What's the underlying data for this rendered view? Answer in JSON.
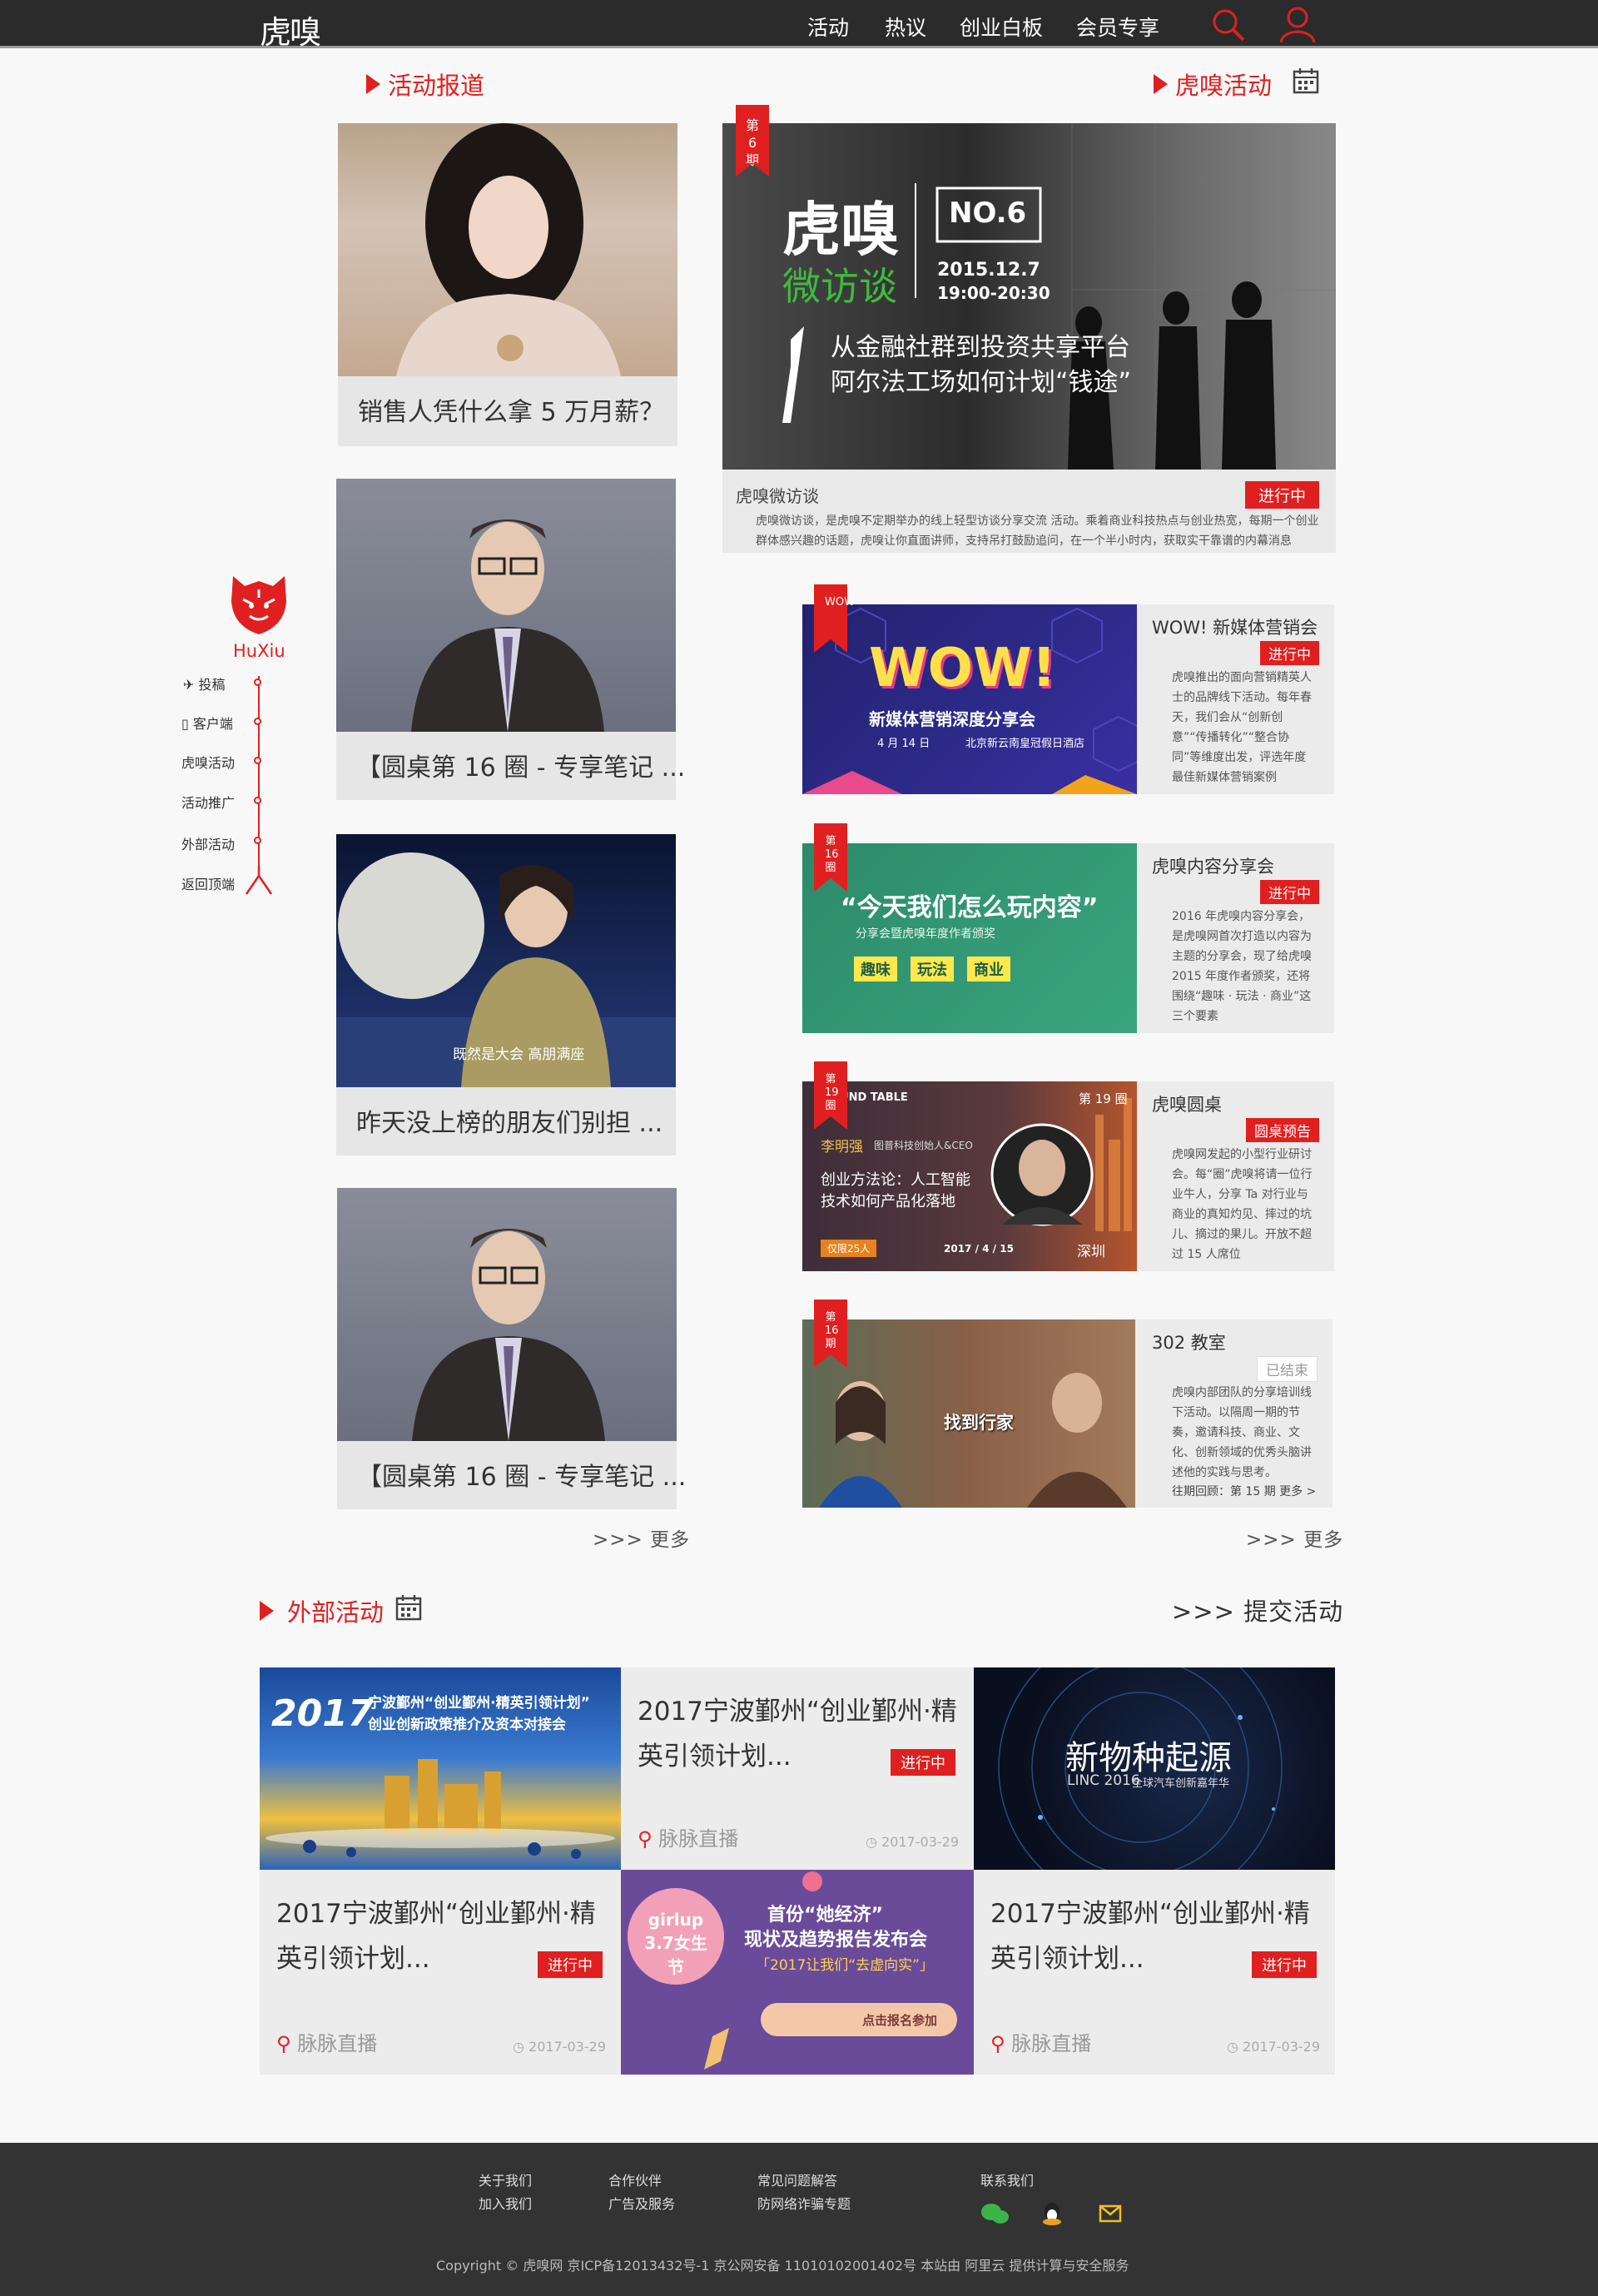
{
  "header": {
    "logo": "虎嗅",
    "nav": [
      "活动",
      "热议",
      "创业白板",
      "会员专享"
    ],
    "search_icon": "search-icon",
    "user_icon": "user-icon"
  },
  "left": {
    "title": "活动报道",
    "cards": [
      "销售人凭什么拿 5 万月薪？",
      "【圆桌第 16 圈 - 专享笔记 ...",
      "昨天没上榜的朋友们别担 ...",
      "【圆桌第 16 圈 - 专享笔记 ..."
    ],
    "more": ">>> 更多"
  },
  "right": {
    "title": "虎嗅活动",
    "calendar_icon": "calendar-icon",
    "featured": {
      "ribbon": "第6期",
      "brand": "虎嗅",
      "sub": "微访谈",
      "no": "NO.6",
      "date": "2015.12.7",
      "time": "19:00-20:30",
      "line1": "从金融社群到投资共享平台",
      "line2": "阿尔法工场如何计划“钱途”",
      "name": "虎嗅微访谈",
      "status": "进行中",
      "desc": "虎嗅微访谈，是虎嗅不定期举办的线上轻型访谈分享交流 活动。乘着商业科技热点与创业热宽，每期一个创业群体感兴趣的话题，虎嗅让你直面讲师，支持吊打鼓励追问，在一个半小时内，获取实干靠谱的内幕消息"
    },
    "events": [
      {
        "ribbon": "WOW",
        "title": "WOW! 新媒体营销会",
        "status": "进行中",
        "desc": "虎嗅推出的面向营销精英人士的品牌线下活动。每年春天，我们会从“创新创意”“传播转化”“整合协同”等维度出发，评选年度最佳新媒体营销案例",
        "pic_title": "WOW!",
        "pic_sub": "新媒体营销深度分享会",
        "pic_date": "4 月 14 日",
        "pic_loc": "北京新云南皇冠假日酒店"
      },
      {
        "ribbon": "第16圈",
        "title": "虎嗅内容分享会",
        "status": "进行中",
        "desc": "2016 年虎嗅内容分享会，是虎嗅网首次打造以内容为主题的分享会，现了给虎嗅 2015 年度作者颁奖，还将围绕“趣味 · 玩法 · 商业”这三个要素",
        "pic_title": "“今天我们怎么玩内容”",
        "pic_sub": "分享会暨虎嗅年度作者颁奖",
        "pic_tags": [
          "趣味",
          "玩法",
          "商业"
        ]
      },
      {
        "ribbon": "第19圈",
        "title": "虎嗅圆桌",
        "status": "圆桌预告",
        "desc": "虎嗅网发起的小型行业研讨会。每“圈”虎嗅将请一位行业牛人，分享 Ta 对行业与商业的真知灼见、摔过的坑儿、摘过的果儿。开放不超过 15 人席位",
        "pic_head": "ROUND TABLE",
        "pic_no": "第 19 圈",
        "pic_name": "李明强",
        "pic_role": "图普科技创始人&CEO",
        "pic_l1": "创业方法论：人工智能",
        "pic_l2": "技术如何产品化落地",
        "pic_limit": "仅限25人",
        "pic_date": "2017 / 4 / 15",
        "pic_city": "深圳"
      },
      {
        "ribbon": "第16期",
        "title": "302 教室",
        "status": "已结束",
        "desc": "虎嗅内部团队的分享培训线下活动。以隔周一期的节奏，邀请科技、商业、文化、创新领域的优秀头脑讲述他的实践与思考。",
        "past": "往期回顾：第 15 期  更多 >",
        "pic_title": "找到行家"
      }
    ],
    "more": ">>> 更多"
  },
  "sidebar": {
    "brand": "HuXiu",
    "items": [
      "投稿",
      "客户端",
      "虎嗅活动",
      "活动推广",
      "外部活动",
      "返回顶端"
    ]
  },
  "external": {
    "title": "外部活动",
    "submit": ">>> 提交活动",
    "items": [
      {
        "title": "2017宁波鄞州“创业鄞州·精英引领计划...",
        "status": "进行中",
        "loc": "脉脉直播",
        "date": "2017-03-29"
      },
      {
        "title": "2017宁波鄞州“创业鄞州·精英引领计划...",
        "status": "进行中",
        "loc": "脉脉直播",
        "date": "2017-03-29"
      },
      {
        "title": "2017宁波鄞州“创业鄞州·精英引领计划...",
        "status": "进行中",
        "loc": "脉脉直播",
        "date": "2017-03-29"
      }
    ],
    "banner1": {
      "year": "2017",
      "l1": "宁波鄞州“创业鄞州·精英引领计划”",
      "l2": "创业创新政策推介及资本对接会"
    },
    "banner2": {
      "l1": "新物种起源",
      "l2": "LINC 2016",
      "l3": "全球汽车创新嘉年华"
    },
    "banner3": {
      "badge": "girlup 3.7女生节",
      "l1": "首份“她经济”",
      "l2": "现状及趋势报告发布会",
      "l3": "「2017让我们“去虚向实”」",
      "btn": "点击报名参加"
    }
  },
  "footer": {
    "links": [
      "关于我们",
      "加入我们",
      "合作伙伴",
      "广告及服务",
      "常见问题解答",
      "防网络诈骗专题",
      "联系我们"
    ],
    "copyright": "Copyright © 虎嗅网 京ICP备12013432号-1  京公网安备 11010102001402号   本站由 阿里云 提供计算与安全服务"
  },
  "colors": {
    "accent": "#e02020",
    "topbar": "#2b2b2b",
    "footer": "#333333"
  }
}
